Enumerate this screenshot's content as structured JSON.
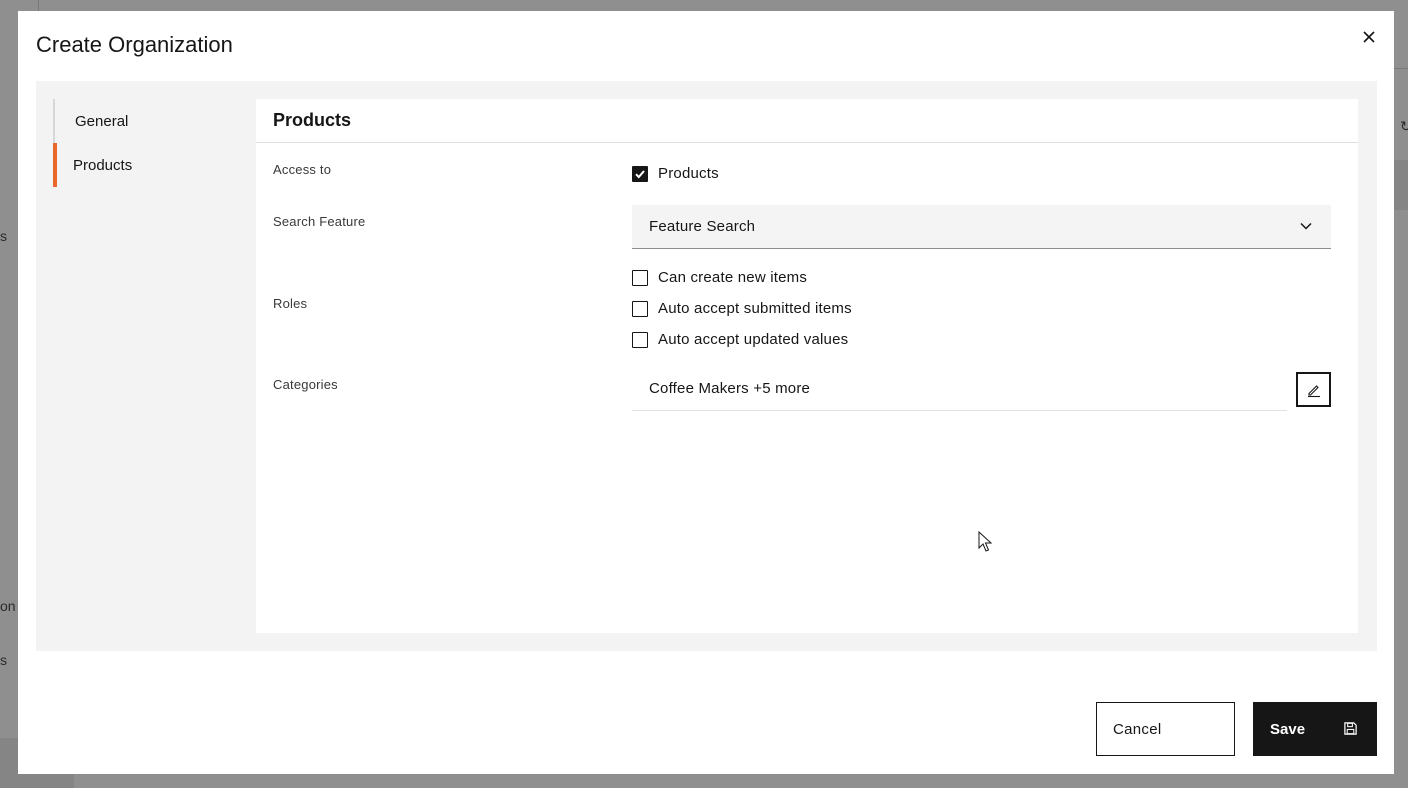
{
  "modal": {
    "title": "Create Organization"
  },
  "nav": {
    "items": [
      {
        "label": "General",
        "active": false
      },
      {
        "label": "Products",
        "active": true
      }
    ]
  },
  "panel": {
    "title": "Products",
    "access_to": {
      "label": "Access to",
      "option_label": "Products",
      "checked": true
    },
    "search_feature": {
      "label": "Search Feature",
      "selected": "Feature Search"
    },
    "roles": {
      "label": "Roles",
      "options": [
        {
          "label": "Can create new items",
          "checked": false
        },
        {
          "label": "Auto accept submitted items",
          "checked": false
        },
        {
          "label": "Auto accept updated values",
          "checked": false
        }
      ]
    },
    "categories": {
      "label": "Categories",
      "value": "Coffee Makers +5 more"
    }
  },
  "footer": {
    "cancel_label": "Cancel",
    "save_label": "Save"
  },
  "background": {
    "fragments": [
      "s",
      "on",
      "s"
    ]
  },
  "colors": {
    "accent": "#e8692a",
    "primary_dark": "#161616",
    "overlay": "#8f8f8f",
    "body_bg": "#f3f3f3"
  }
}
